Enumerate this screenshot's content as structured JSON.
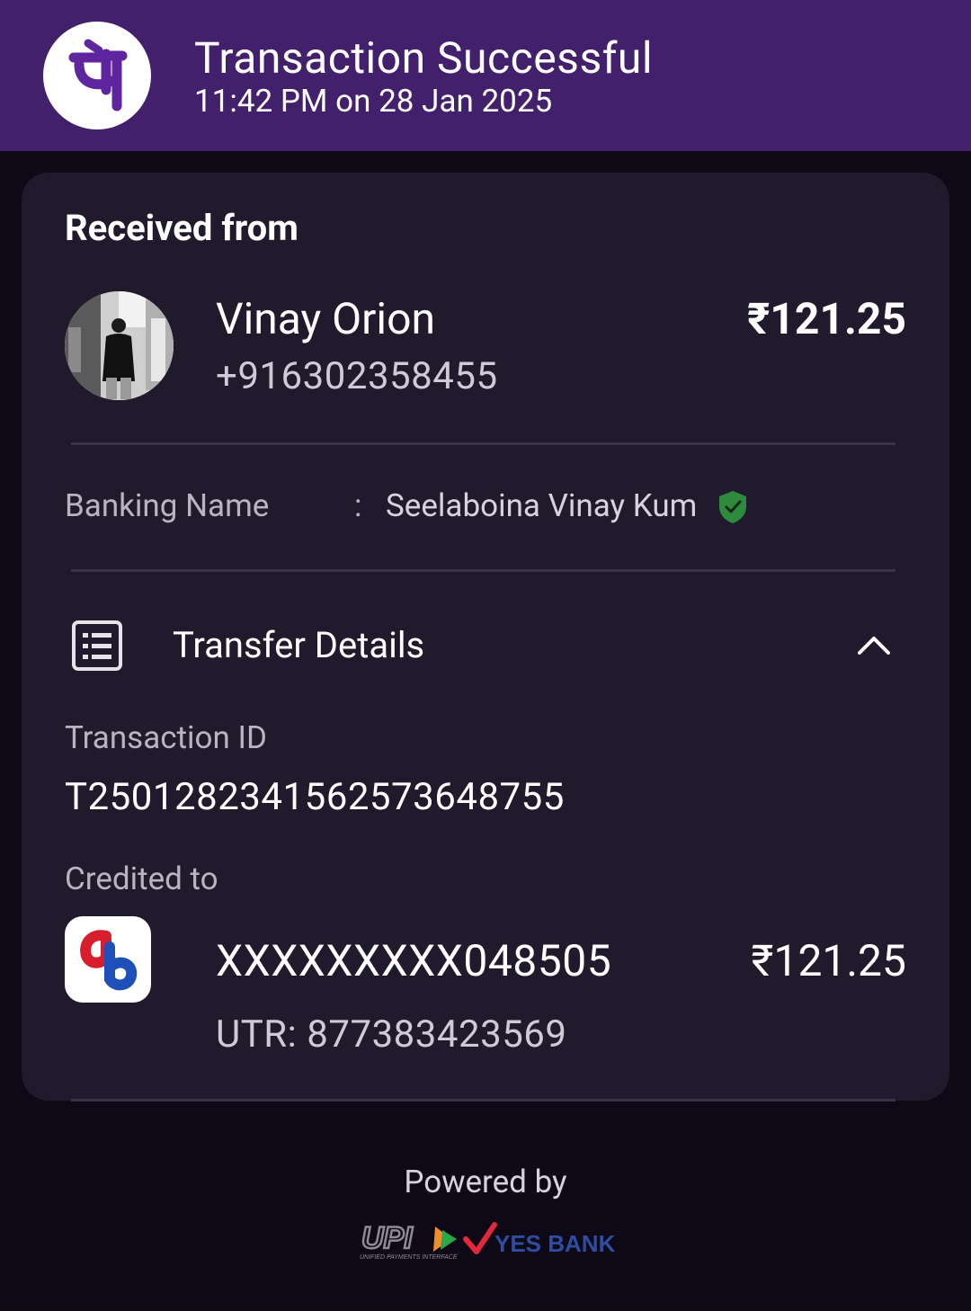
{
  "header": {
    "title": "Transaction Successful",
    "datetime": "11:42 PM on 28 Jan 2025",
    "brand_color": "#42206b",
    "logo_icon": "phonepe-logo-icon"
  },
  "received": {
    "section_title": "Received from",
    "sender_name": "Vinay Orion",
    "sender_phone": "+916302358455",
    "amount": "₹121.25"
  },
  "banking": {
    "label": "Banking Name",
    "separator": ":",
    "value": "Seelaboina Vinay Kum",
    "verified_icon": "verified-shield-icon",
    "verified_color": "#2e8b3e"
  },
  "transfer": {
    "title": "Transfer Details",
    "expanded": true,
    "txid_label": "Transaction ID",
    "txid_value": "T2501282341562573648755",
    "credited_label": "Credited to",
    "account_number": "XXXXXXXXX048505",
    "amount": "₹121.25",
    "utr": "UTR: 877383423569"
  },
  "footer": {
    "powered_by": "Powered by",
    "upi_text": "UPI",
    "upi_tagline": "UNIFIED PAYMENTS INTERFACE",
    "bank_text": "YES BANK"
  }
}
